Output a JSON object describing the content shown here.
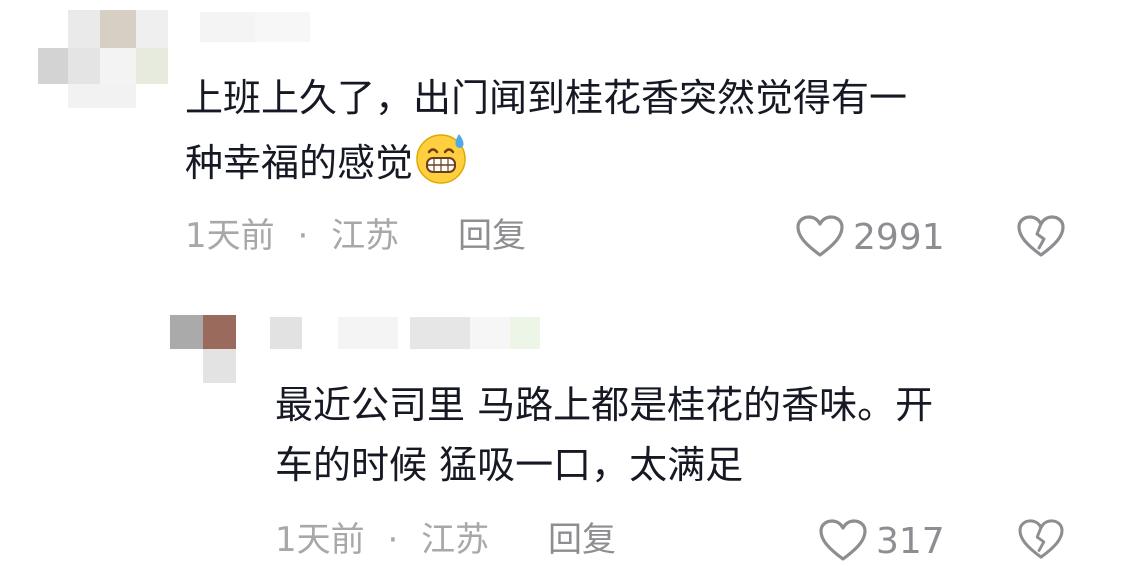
{
  "comments": [
    {
      "text_line1": "上班上久了，出门闻到桂花香突然觉得有一",
      "text_line2": "种幸福的感觉",
      "emoji": "grinning-sweat-emoji",
      "time": "1天前",
      "separator": "·",
      "location": "江苏",
      "reply_label": "回复",
      "like_count": "2991"
    },
    {
      "text_line1": "最近公司里 马路上都是桂花的香味。开",
      "text_line2": "车的时候 猛吸一口，太满足",
      "time": "1天前",
      "separator": "·",
      "location": "江苏",
      "reply_label": "回复",
      "like_count": "317"
    }
  ],
  "icons": {
    "like": "heart-outline-icon",
    "dislike": "broken-heart-icon"
  },
  "colors": {
    "text": "#161823",
    "meta": "#a8a8ab",
    "icon": "#8e8e92"
  }
}
